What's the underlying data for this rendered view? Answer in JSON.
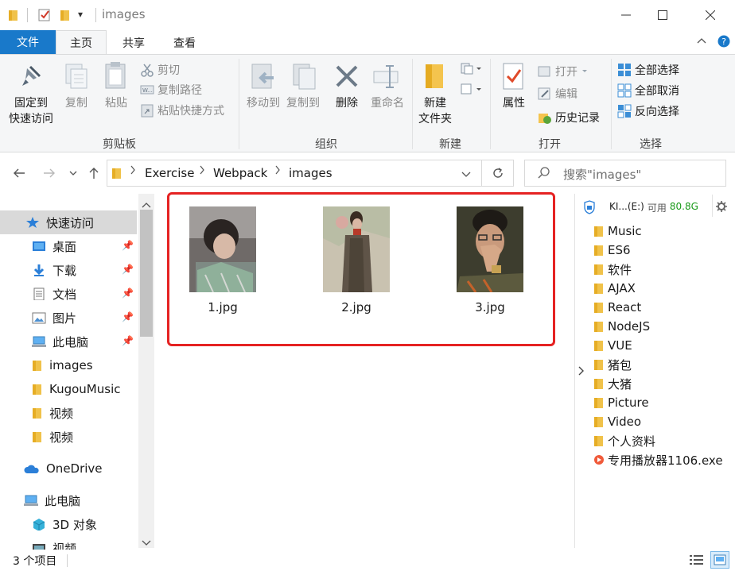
{
  "titlebar": {
    "title": "images",
    "qa_dropdown": "▾"
  },
  "ribbon": {
    "tabs": {
      "file": "文件",
      "home": "主页",
      "share": "共享",
      "view": "查看"
    },
    "clipboard": {
      "pin": "固定到",
      "pin2": "快速访问",
      "copy": "复制",
      "paste": "粘贴",
      "cut": "剪切",
      "copy_path": "复制路径",
      "paste_shortcut": "粘贴快捷方式",
      "label": "剪贴板"
    },
    "organize": {
      "move_to": "移动到",
      "copy_to": "复制到",
      "delete": "删除",
      "rename": "重命名",
      "label": "组织"
    },
    "new": {
      "new_folder": "新建",
      "new_folder2": "文件夹",
      "label": "新建"
    },
    "open": {
      "properties": "属性",
      "open": "打开",
      "edit": "编辑",
      "history": "历史记录",
      "label": "打开"
    },
    "select": {
      "select_all": "全部选择",
      "select_none": "全部取消",
      "invert": "反向选择",
      "label": "选择"
    }
  },
  "address": {
    "crumbs": [
      "Exercise",
      "Webpack",
      "images"
    ],
    "search_placeholder": "搜索\"images\""
  },
  "nav": {
    "items": [
      {
        "label": "快速访问",
        "icon": "star-icon"
      },
      {
        "label": "桌面",
        "icon": "desktop-icon"
      },
      {
        "label": "下载",
        "icon": "download-icon"
      },
      {
        "label": "文档",
        "icon": "document-icon"
      },
      {
        "label": "图片",
        "icon": "picture-icon"
      },
      {
        "label": "此电脑",
        "icon": "computer-icon"
      },
      {
        "label": "images",
        "icon": "folder-icon"
      },
      {
        "label": "KugouMusic",
        "icon": "folder-icon"
      },
      {
        "label": "视频",
        "icon": "folder-icon"
      },
      {
        "label": "视频",
        "icon": "folder-icon"
      },
      {
        "label": "OneDrive",
        "icon": "cloud-icon"
      },
      {
        "label": "此电脑",
        "icon": "computer-icon"
      },
      {
        "label": "3D 对象",
        "icon": "cube-icon"
      },
      {
        "label": "视频",
        "icon": "video-icon"
      }
    ]
  },
  "files": [
    {
      "name": "1.jpg"
    },
    {
      "name": "2.jpg"
    },
    {
      "name": "3.jpg"
    }
  ],
  "right_panel": {
    "drive": "KI...(E:)",
    "free_label": "可用",
    "free_value": "80.8G",
    "items": [
      "Music",
      "ES6",
      "软件",
      "AJAX",
      "React",
      "NodeJS",
      "VUE",
      "猪包",
      "大猪",
      "Picture",
      "Video",
      "个人资料",
      "专用播放器1106.exe"
    ]
  },
  "status": {
    "count": "3 个项目"
  },
  "colors": {
    "accent": "#1979ca",
    "highlight": "#e52222",
    "free_space": "#1a9a1a"
  }
}
